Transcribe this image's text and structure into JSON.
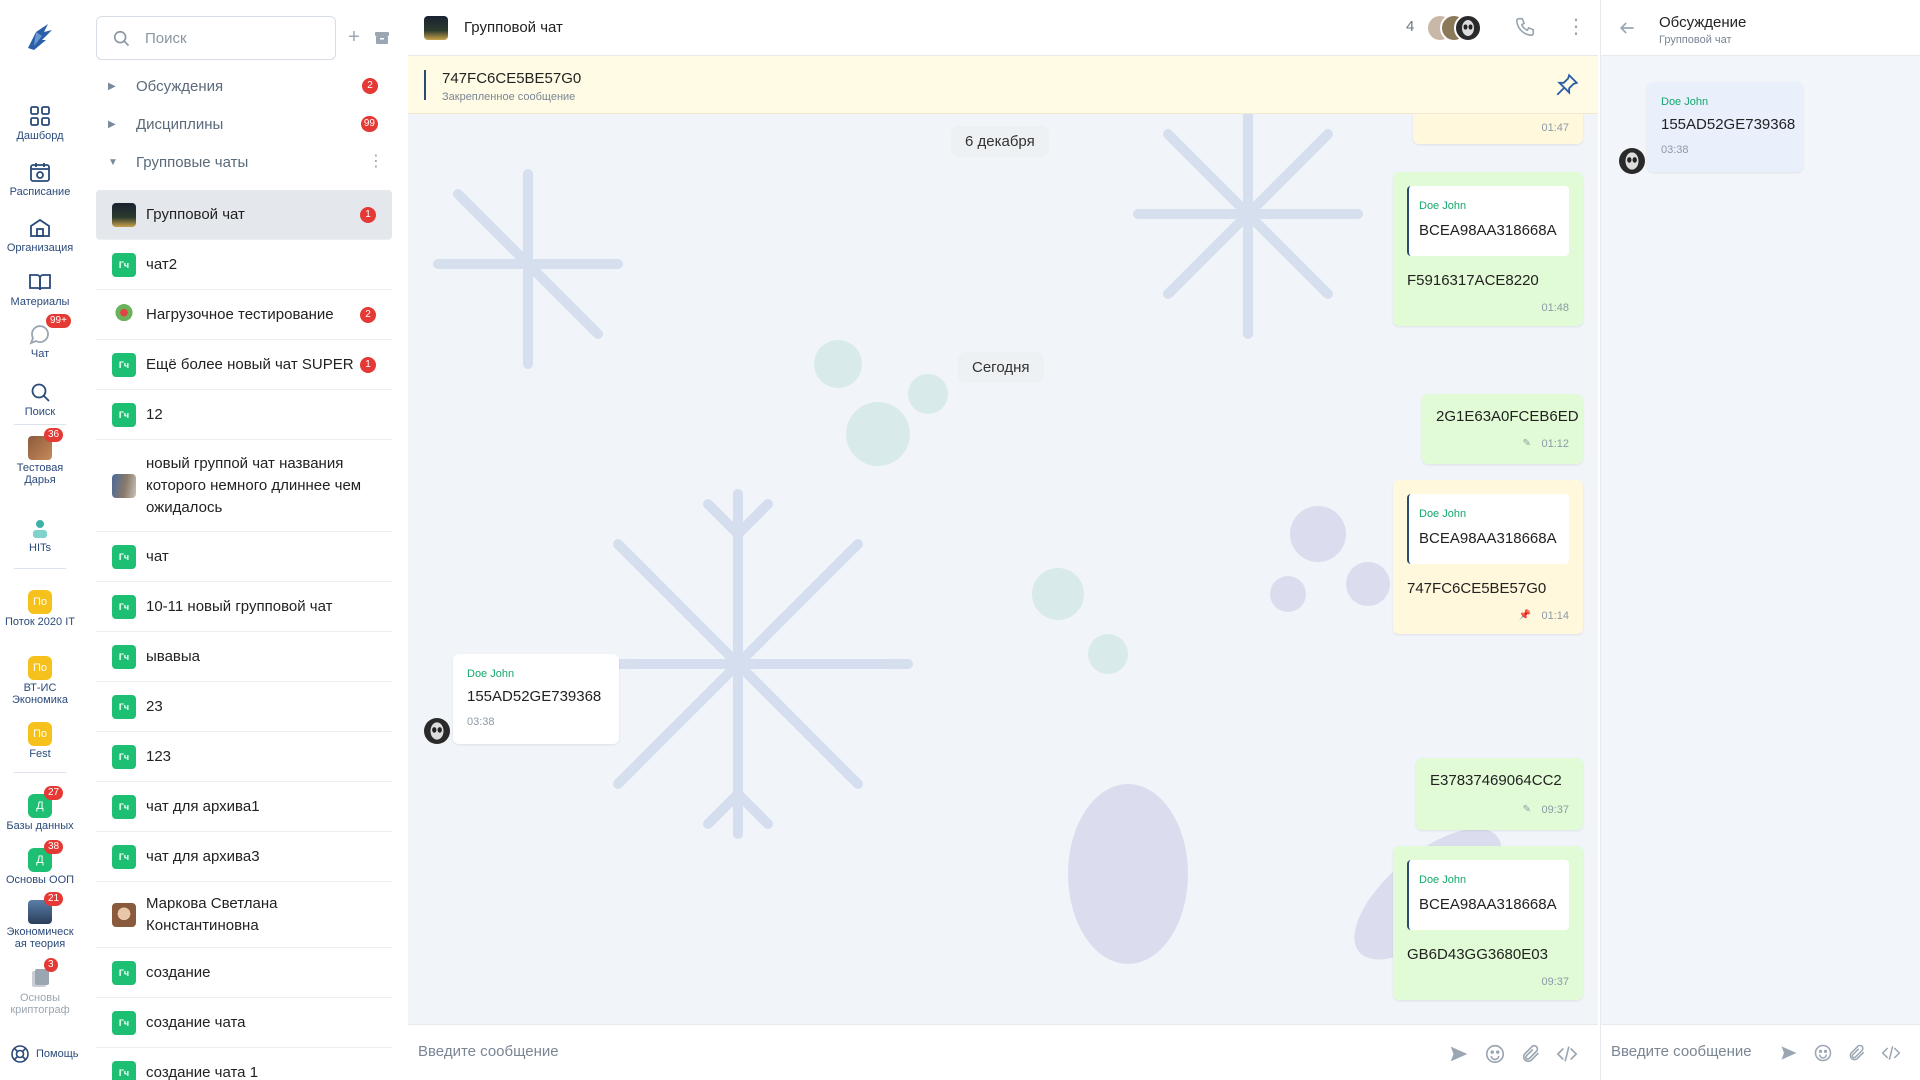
{
  "rail": {
    "items": [
      {
        "label": "Дашборд",
        "icon": "dashboard-icon"
      },
      {
        "label": "Расписание",
        "icon": "calendar-icon"
      },
      {
        "label": "Организация",
        "icon": "building-icon"
      },
      {
        "label": "Материалы",
        "icon": "book-icon"
      },
      {
        "label": "Чат",
        "icon": "chat-icon",
        "badge": "99+"
      },
      {
        "label": "Поиск",
        "icon": "search-icon"
      }
    ],
    "courses": [
      {
        "label": "Тестовая Дарья",
        "badge": "36"
      },
      {
        "label": "HITs",
        "badge": ""
      },
      {
        "label": "Поток 2020 IT",
        "avatar": "По"
      },
      {
        "label": "ВТ-ИС Экономика",
        "avatar": "По"
      },
      {
        "label": "Fest",
        "avatar": "По"
      },
      {
        "label": "Базы данных",
        "avatar": "Д",
        "badge": "27"
      },
      {
        "label": "Основы ООП",
        "avatar": "Д",
        "badge": "38"
      },
      {
        "label": "Экономическ ая теория",
        "badge": "21"
      },
      {
        "label": "Основы криптограф",
        "badge": "3"
      }
    ],
    "help": "Помощь"
  },
  "sidebar": {
    "search_placeholder": "Поиск",
    "sections": [
      {
        "label": "Обсуждения",
        "badge": "2"
      },
      {
        "label": "Дисциплины",
        "badge": "99"
      },
      {
        "label": "Групповые чаты",
        "badge": ""
      }
    ],
    "chat_avatar_text": "Гч",
    "chats": [
      {
        "name": "Групповой чат",
        "badge": "1",
        "avatar": "photo-night"
      },
      {
        "name": "чат2",
        "badge": "",
        "avatar": "gch"
      },
      {
        "name": "Нагрузочное тестирование",
        "badge": "2",
        "avatar": "photo-toy"
      },
      {
        "name": "Ещё более новый чат SUPER",
        "badge": "1",
        "avatar": "gch"
      },
      {
        "name": "12",
        "badge": "",
        "avatar": "gch"
      },
      {
        "name": "новый группой чат названия которого немного длиннее чем ожидалось",
        "badge": "",
        "avatar": "photo-street"
      },
      {
        "name": "чат",
        "badge": "",
        "avatar": "gch"
      },
      {
        "name": "10-11 новый групповой чат",
        "badge": "",
        "avatar": "gch"
      },
      {
        "name": "ывавыа",
        "badge": "",
        "avatar": "gch"
      },
      {
        "name": "23",
        "badge": "",
        "avatar": "gch"
      },
      {
        "name": "123",
        "badge": "",
        "avatar": "gch"
      },
      {
        "name": "чат для архива1",
        "badge": "",
        "avatar": "gch"
      },
      {
        "name": "чат для архива3",
        "badge": "",
        "avatar": "gch"
      },
      {
        "name": "Маркова Светлана Константиновна",
        "badge": "",
        "avatar": "photo-person"
      },
      {
        "name": "создание",
        "badge": "",
        "avatar": "gch"
      },
      {
        "name": "создание чата",
        "badge": "",
        "avatar": "gch"
      },
      {
        "name": "создание чата 1",
        "badge": "",
        "avatar": "gch"
      }
    ]
  },
  "header": {
    "title": "Групповой чат",
    "members_count": "4"
  },
  "pinned": {
    "text": "747FC6CE5BE57G0",
    "caption": "Закрепленное сообщение"
  },
  "messages": {
    "top_time": "01:47",
    "date1": "6 декабря",
    "m1": {
      "author": "Doe John",
      "quote": "BCEA98AA318668A",
      "text": "F5916317ACE8220",
      "time": "01:48"
    },
    "date2": "Сегодня",
    "m2": {
      "text": "2G1E63A0FCEB6ED",
      "time": "01:12"
    },
    "m3": {
      "author": "Doe John",
      "quote": "BCEA98AA318668A",
      "text": "747FC6CE5BE57G0",
      "time": "01:14"
    },
    "m4": {
      "author": "Doe John",
      "text": "155AD52GE739368",
      "time": "03:38"
    },
    "m5": {
      "text": "E37837469064CC2",
      "time": "09:37"
    },
    "m6": {
      "author": "Doe John",
      "quote": "BCEA98AA318668A",
      "text": "GB6D43GG3680E03",
      "time": "09:37"
    }
  },
  "composer": {
    "placeholder": "Введите сообщение"
  },
  "thread": {
    "title": "Обсуждение",
    "subtitle": "Групповой чат",
    "message": {
      "author": "Doe John",
      "text": "155AD52GE739368",
      "time": "03:38"
    },
    "placeholder": "Введите сообщение"
  },
  "colors": {
    "accent": "#2a4a7a",
    "badge": "#e53935",
    "outgoing_bubble": "#e1fbd6",
    "pinned_bg": "#fffbe5",
    "author_green": "#13a86b"
  }
}
